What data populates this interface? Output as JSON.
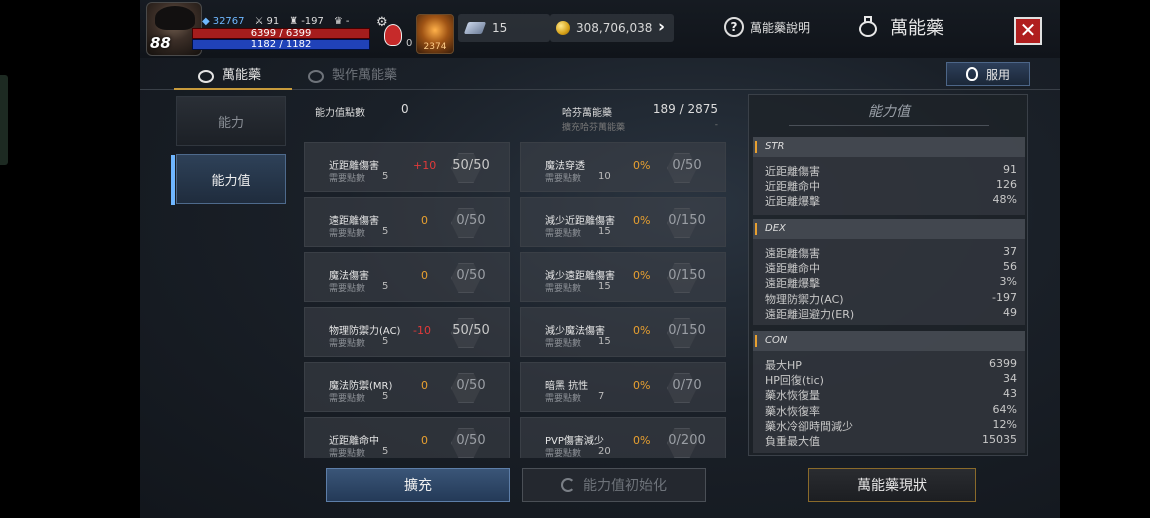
{
  "hud": {
    "level": "88",
    "exp": "32767",
    "stat2": "91",
    "stat3": "-197",
    "stat4": "-",
    "hp": "6399 / 6399",
    "mp": "1182 / 1182",
    "potion_count": "0",
    "buff_timer": "2374",
    "crystal": "15",
    "gold": "308,706,038",
    "help_label": "萬能藥說明",
    "title": "萬能藥"
  },
  "tabs": {
    "elixir": "萬能藥",
    "craft": "製作萬能藥",
    "use_button": "服用"
  },
  "side_nav": {
    "ability": "能力",
    "stats": "能力值"
  },
  "points": {
    "label": "能力值點數",
    "value": "0"
  },
  "halfen": {
    "label": "哈芬萬能藥",
    "value": "189 / 2875",
    "sub_label": "擴充哈芬萬能藥",
    "sub_value": "-"
  },
  "need_label": "需要點數",
  "cards_left": [
    {
      "name": "近距離傷害",
      "need": "5",
      "bonus": "+10",
      "progress": "50/50"
    },
    {
      "name": "遠距離傷害",
      "need": "5",
      "bonus": "0",
      "progress": "0/50"
    },
    {
      "name": "魔法傷害",
      "need": "5",
      "bonus": "0",
      "progress": "0/50"
    },
    {
      "name": "物理防禦力(AC)",
      "need": "5",
      "bonus": "-10",
      "progress": "50/50"
    },
    {
      "name": "魔法防禦(MR)",
      "need": "5",
      "bonus": "0",
      "progress": "0/50"
    },
    {
      "name": "近距離命中",
      "need": "5",
      "bonus": "0",
      "progress": "0/50"
    }
  ],
  "cards_right": [
    {
      "name": "魔法穿透",
      "need": "10",
      "bonus": "0%",
      "progress": "0/50"
    },
    {
      "name": "減少近距離傷害",
      "need": "15",
      "bonus": "0%",
      "progress": "0/150"
    },
    {
      "name": "減少遠距離傷害",
      "need": "15",
      "bonus": "0%",
      "progress": "0/150"
    },
    {
      "name": "減少魔法傷害",
      "need": "15",
      "bonus": "0%",
      "progress": "0/150"
    },
    {
      "name": "暗黑 抗性",
      "need": "7",
      "bonus": "0%",
      "progress": "0/70"
    },
    {
      "name": "PVP傷害減少",
      "need": "20",
      "bonus": "0%",
      "progress": "0/200"
    }
  ],
  "stats_panel": {
    "title": "能力值",
    "groups": [
      {
        "name": "STR",
        "rows": [
          {
            "k": "近距離傷害",
            "v": "91"
          },
          {
            "k": "近距離命中",
            "v": "126"
          },
          {
            "k": "近距離爆擊",
            "v": "48%"
          }
        ]
      },
      {
        "name": "DEX",
        "rows": [
          {
            "k": "遠距離傷害",
            "v": "37"
          },
          {
            "k": "遠距離命中",
            "v": "56"
          },
          {
            "k": "遠距離爆擊",
            "v": "3%"
          },
          {
            "k": "物理防禦力(AC)",
            "v": "-197"
          },
          {
            "k": "遠距離迴避力(ER)",
            "v": "49"
          }
        ]
      },
      {
        "name": "CON",
        "rows": [
          {
            "k": "最大HP",
            "v": "6399"
          },
          {
            "k": "HP回復(tic)",
            "v": "34"
          },
          {
            "k": "藥水恢復量",
            "v": "43"
          },
          {
            "k": "藥水恢復率",
            "v": "64%"
          },
          {
            "k": "藥水冷卻時間減少",
            "v": "12%"
          },
          {
            "k": "負重最大值",
            "v": "15035"
          }
        ]
      }
    ]
  },
  "buttons": {
    "expand": "擴充",
    "reset": "能力值初始化",
    "status": "萬能藥現狀"
  },
  "colors": {
    "positive": "#e03a3a",
    "percent": "#e8a030",
    "accent": "#c89b3c"
  }
}
